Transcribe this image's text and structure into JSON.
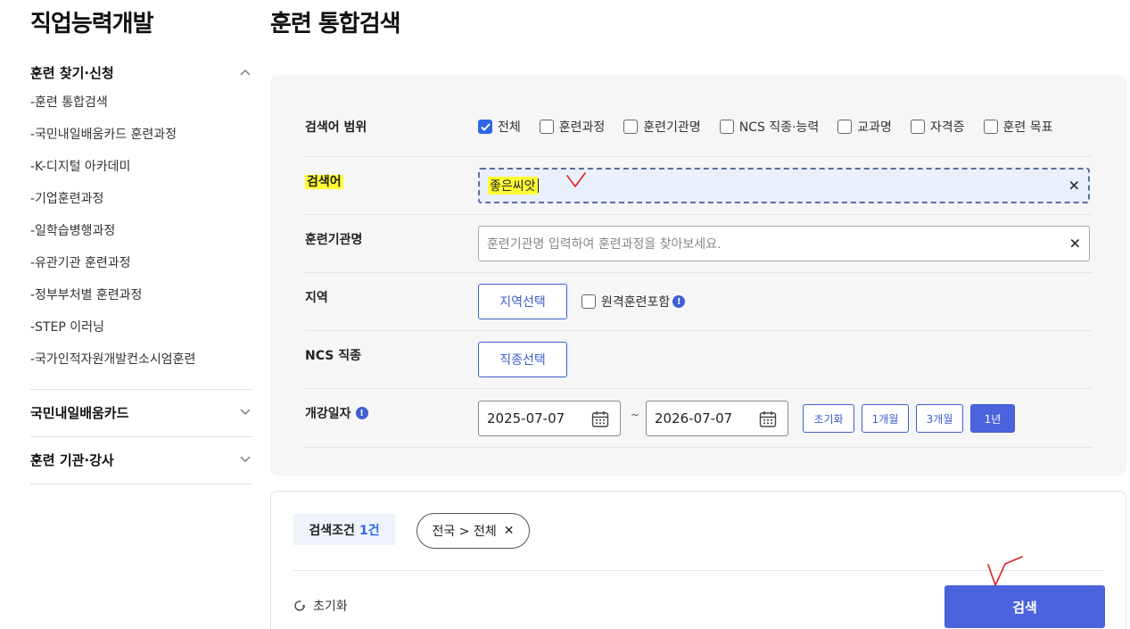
{
  "sidebar": {
    "title": "직업능력개발",
    "groups": [
      {
        "label": "훈련 찾기·신청",
        "items": [
          {
            "label": "-훈련 통합검색"
          },
          {
            "label": "-국민내일배움카드 훈련과정"
          },
          {
            "label": "-K-디지털 아카데미"
          },
          {
            "label": "-기업훈련과정"
          },
          {
            "label": "-일학습병행과정"
          },
          {
            "label": "-유관기관 훈련과정"
          },
          {
            "label": "-정부부처별 훈련과정"
          },
          {
            "label": "-STEP 이러닝"
          },
          {
            "label": "-국가인적자원개발컨소시엄훈련"
          }
        ]
      },
      {
        "label": "국민내일배움카드"
      },
      {
        "label": "훈련 기관·강사"
      }
    ]
  },
  "main": {
    "title": "훈련 통합검색",
    "search_scope": {
      "label": "검색어 범위",
      "options": [
        {
          "label": "전체",
          "checked": true
        },
        {
          "label": "훈련과정",
          "checked": false
        },
        {
          "label": "훈련기관명",
          "checked": false
        },
        {
          "label": "NCS 직종·능력",
          "checked": false
        },
        {
          "label": "교과명",
          "checked": false
        },
        {
          "label": "자격증",
          "checked": false
        },
        {
          "label": "훈련 목표",
          "checked": false
        }
      ]
    },
    "keyword": {
      "label": "검색어",
      "value": "좋은씨앗"
    },
    "institution": {
      "label": "훈련기관명",
      "placeholder": "훈련기관명 입력하여 훈련과정을 찾아보세요."
    },
    "region": {
      "label": "지역",
      "button": "지역선택",
      "remote_checkbox": "원격훈련포함",
      "remote_checked": false
    },
    "ncs": {
      "label": "NCS 직종",
      "button": "직종선택"
    },
    "date": {
      "label": "개강일자",
      "start": "2025-07-07",
      "separator": "~",
      "end": "2026-07-07",
      "buttons": [
        {
          "label": "초기화",
          "active": false
        },
        {
          "label": "1개월",
          "active": false
        },
        {
          "label": "3개월",
          "active": false
        },
        {
          "label": "1년",
          "active": true
        }
      ]
    },
    "result": {
      "conditions_label": "검색조건",
      "conditions_count": "1건",
      "chip": "전국 > 전체",
      "reset": "초기화",
      "search": "검색"
    }
  },
  "colors": {
    "accent": "#4b63dc",
    "checkbox": "#2f66e6",
    "highlight": "#ffff33",
    "annotation": "#e02020"
  },
  "icons": {
    "close": "close-icon",
    "calendar": "calendar-icon",
    "chevron_up": "chevron-up-icon",
    "chevron_down": "chevron-down-icon",
    "info": "info-icon",
    "refresh": "refresh-icon"
  }
}
